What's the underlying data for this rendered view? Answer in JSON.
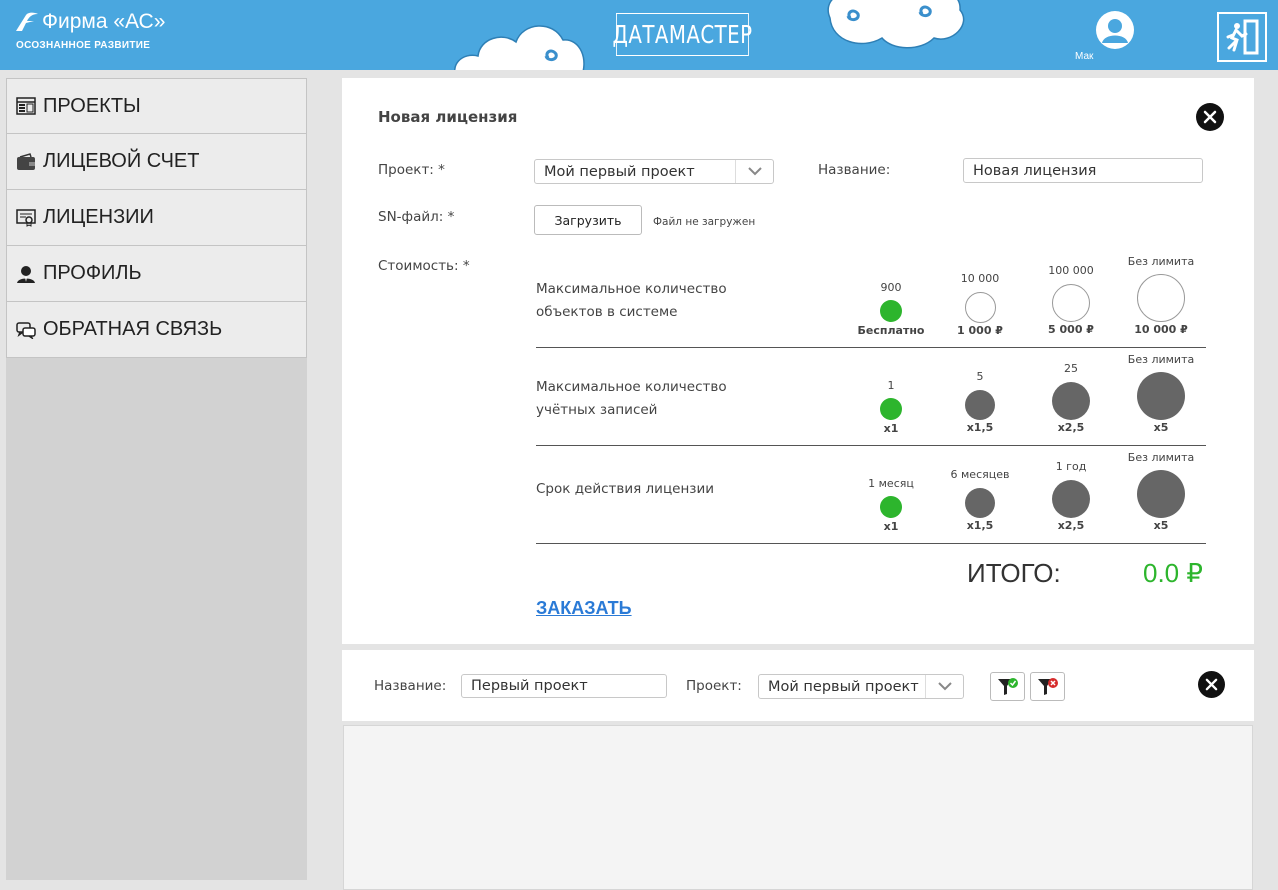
{
  "header": {
    "company_name": "Фирма «АС»",
    "company_tagline": "ОСОЗНАННОЕ РАЗВИТИЕ",
    "brand_logo": "ДАТАМАСТЕР",
    "user_name": "Мак",
    "user_icon": "user-avatar-icon",
    "exit_icon": "exit-door-icon",
    "accent_color": "#4aa7df"
  },
  "sidebar": {
    "items": [
      {
        "label": "ПРОЕКТЫ",
        "icon": "projects-icon"
      },
      {
        "label": "ЛИЦЕВОЙ СЧЕТ",
        "icon": "wallet-icon"
      },
      {
        "label": "ЛИЦЕНЗИИ",
        "icon": "certificate-icon"
      },
      {
        "label": "ПРОФИЛЬ",
        "icon": "profile-icon"
      },
      {
        "label": "ОБРАТНАЯ СВЯЗЬ",
        "icon": "feedback-icon"
      }
    ]
  },
  "license_form": {
    "title": "Новая лицензия",
    "project_label": "Проект: *",
    "project_value": "Мой первый проект",
    "name_label": "Название:",
    "name_value": "Новая лицензия",
    "sn_label": "SN-файл: *",
    "upload_button": "Загрузить",
    "file_status": "Файл не загружен",
    "cost_label": "Стоимость: *",
    "rows": [
      {
        "label_line1": "Максимальное количество",
        "label_line2": "объектов в системе",
        "options": [
          {
            "top": "900",
            "bottom": "Бесплатно",
            "selected": true
          },
          {
            "top": "10 000",
            "bottom": "1 000 ₽",
            "selected": false
          },
          {
            "top": "100 000",
            "bottom": "5 000 ₽",
            "selected": false
          },
          {
            "top": "Без лимита",
            "bottom": "10 000 ₽",
            "selected": false
          }
        ]
      },
      {
        "label_line1": "Максимальное количество",
        "label_line2": "учётных записей",
        "options": [
          {
            "top": "1",
            "bottom": "x1",
            "selected": true
          },
          {
            "top": "5",
            "bottom": "x1,5",
            "selected": false
          },
          {
            "top": "25",
            "bottom": "x2,5",
            "selected": false
          },
          {
            "top": "Без лимита",
            "bottom": "x5",
            "selected": false
          }
        ]
      },
      {
        "label_line1": "Срок действия лицензии",
        "label_line2": "",
        "options": [
          {
            "top": "1 месяц",
            "bottom": "x1",
            "selected": true
          },
          {
            "top": "6 месяцев",
            "bottom": "x1,5",
            "selected": false
          },
          {
            "top": "1 год",
            "bottom": "x2,5",
            "selected": false
          },
          {
            "top": "Без лимита",
            "bottom": "x5",
            "selected": false
          }
        ]
      }
    ],
    "total_label": "ИТОГО:",
    "total_value": "0.0 ₽",
    "order_link": "ЗАКАЗАТЬ",
    "selected_color": "#2db52d",
    "inactive_color": "#666666"
  },
  "filter_bar": {
    "name_label": "Название:",
    "name_value": "Первый проект",
    "project_label": "Проект:",
    "project_value": "Мой первый проект",
    "apply_icon": "filter-apply-icon",
    "clear_icon": "filter-clear-icon"
  }
}
